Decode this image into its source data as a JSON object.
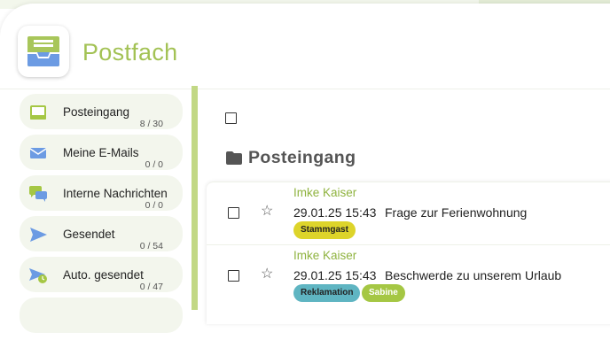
{
  "app": {
    "title": "Postfach"
  },
  "sidebar": {
    "items": [
      {
        "label": "Posteingang",
        "count": "8 / 30",
        "icon": "inbox-icon"
      },
      {
        "label": "Meine E-Mails",
        "count": "0 / 0",
        "icon": "envelope-icon"
      },
      {
        "label": "Interne Nachrichten",
        "count": "0 / 0",
        "icon": "chat-bubbles-icon"
      },
      {
        "label": "Gesendet",
        "count": "0 / 54",
        "icon": "send-icon"
      },
      {
        "label": "Auto. gesendet",
        "count": "0 / 47",
        "icon": "auto-send-icon"
      }
    ]
  },
  "main": {
    "folder_title": "Posteingang",
    "mails": [
      {
        "sender": "Imke Kaiser",
        "date": "29.01.25 15:43",
        "subject": "Frage zur Ferienwohnung",
        "tags": [
          {
            "label": "Stammgast",
            "color": "#ddd42a"
          }
        ]
      },
      {
        "sender": "Imke Kaiser",
        "date": "29.01.25 15:43",
        "subject": "Beschwerde zu unserem Urlaub",
        "tags": [
          {
            "label": "Reklamation",
            "color": "#5fb5c2"
          },
          {
            "label": "Sabine",
            "color": "#a5c744"
          }
        ]
      }
    ]
  },
  "colors": {
    "accent": "#a3c255",
    "nav_bg": "#f3f6ed",
    "icon_blue": "#6c9be3"
  }
}
